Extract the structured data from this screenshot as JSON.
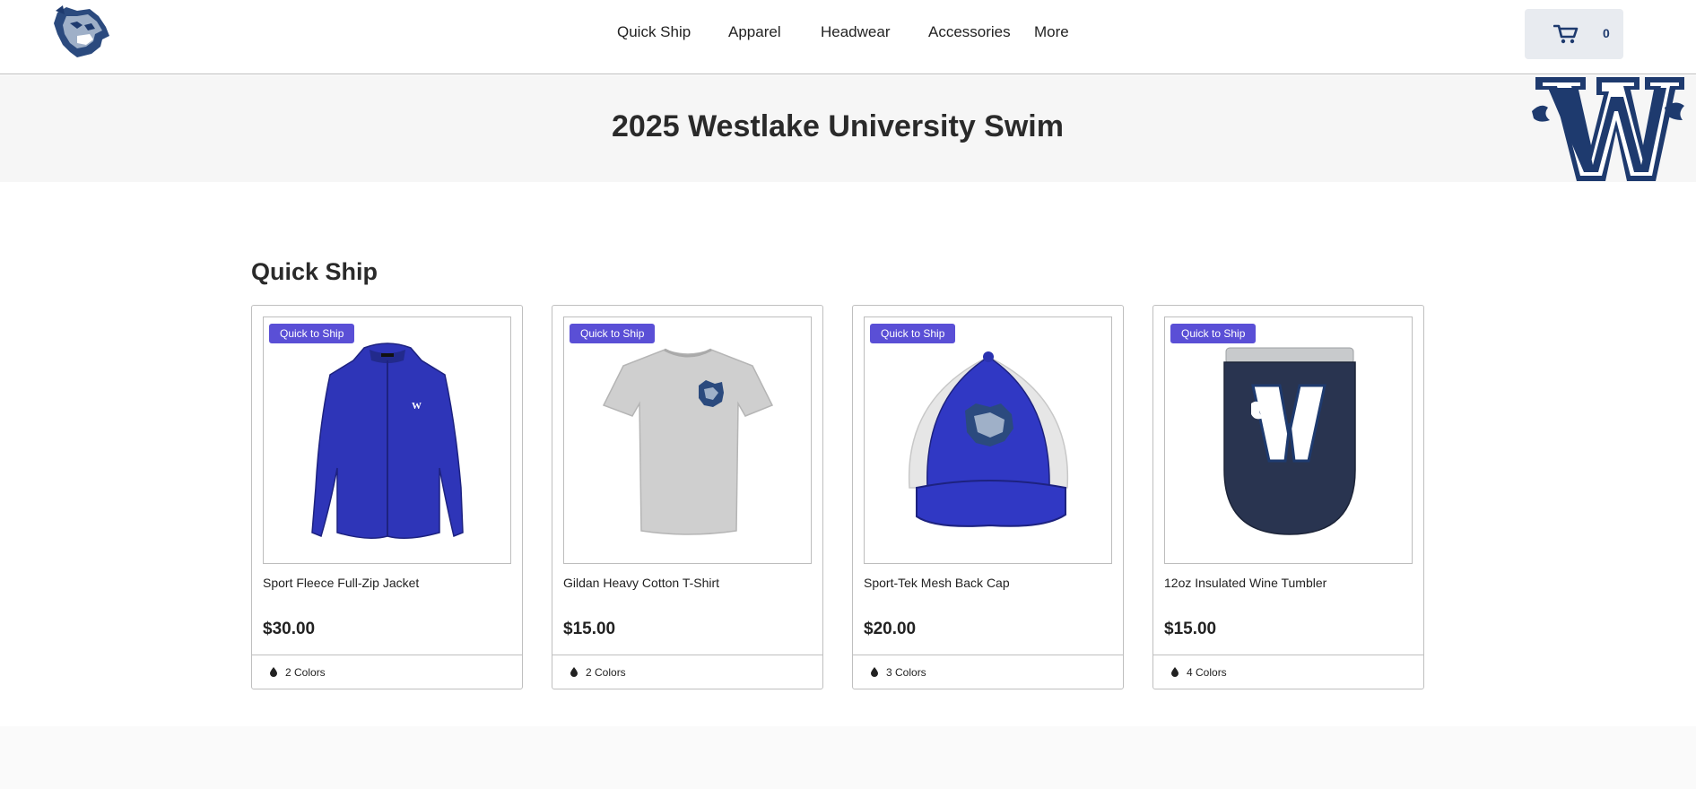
{
  "header": {
    "logo_icon": "wildcat-logo-icon",
    "nav": [
      "Quick Ship",
      "Apparel",
      "Headwear",
      "Accessories",
      "More"
    ],
    "cart": {
      "icon": "cart-icon",
      "count": "0"
    }
  },
  "banner": {
    "title": "2025 Westlake University Swim",
    "logo_icon": "w-logo-icon"
  },
  "section": {
    "title": "Quick Ship",
    "products": [
      {
        "badge": "Quick to Ship",
        "name": "Sport Fleece Full-Zip Jacket",
        "price": "$30.00",
        "colors": "2 Colors",
        "image": "blue-fleece-jacket"
      },
      {
        "badge": "Quick to Ship",
        "name": "Gildan Heavy Cotton T-Shirt",
        "price": "$15.00",
        "colors": "2 Colors",
        "image": "grey-tshirt"
      },
      {
        "badge": "Quick to Ship",
        "name": "Sport-Tek Mesh Back Cap",
        "price": "$20.00",
        "colors": "3 Colors",
        "image": "blue-mesh-cap"
      },
      {
        "badge": "Quick to Ship",
        "name": "12oz Insulated Wine Tumbler",
        "price": "$15.00",
        "colors": "4 Colors",
        "image": "navy-tumbler"
      }
    ]
  },
  "colors": {
    "badge": "#5a4fd6",
    "brand_navy": "#1e3a6e",
    "royal_blue": "#2e35b8",
    "banner_bg": "#f6f6f6",
    "cart_bg": "#e8ebf0"
  }
}
